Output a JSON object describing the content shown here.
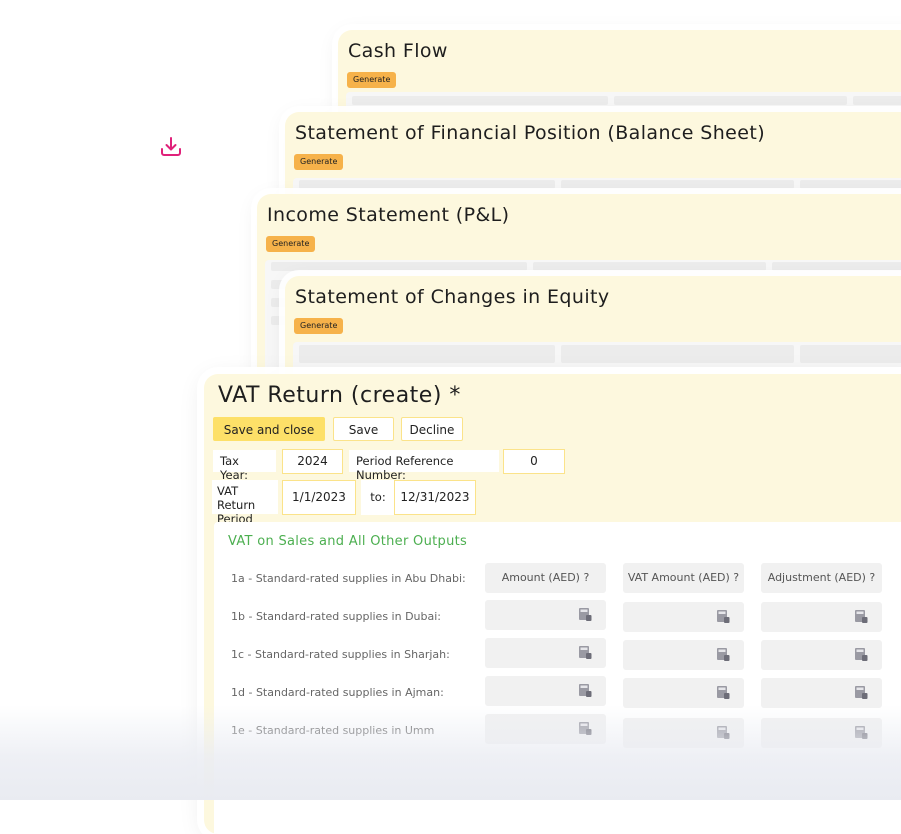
{
  "icons": {
    "download": "download-icon",
    "calculator": "calculator-icon",
    "accent_color": "#e0217a"
  },
  "cards": [
    {
      "title": "Cash Flow",
      "button": "Generate"
    },
    {
      "title": "Statement of Financial Position (Balance Sheet)",
      "button": "Generate"
    },
    {
      "title": "Income Statement (P&L)",
      "button": "Generate"
    },
    {
      "title": "Statement of Changes in Equity",
      "button": "Generate"
    }
  ],
  "vat": {
    "title": "VAT Return (create) *",
    "actions": {
      "save_close": "Save and close",
      "save": "Save",
      "decline": "Decline"
    },
    "tax_year_label": "Tax Year:",
    "tax_year": "2024",
    "period_ref_label": "Period Reference Number:",
    "period_ref": "0",
    "period_label": "VAT Return Period",
    "period_from": "1/1/2023",
    "to_label": "to:",
    "period_to": "12/31/2023",
    "section_title": "VAT on Sales and All Other Outputs",
    "columns": [
      "Amount (AED) ?",
      "VAT Amount (AED) ?",
      "Adjustment (AED) ?"
    ],
    "rows": [
      "1a - Standard-rated supplies in Abu Dhabi:",
      "1b - Standard-rated supplies in Dubai:",
      "1c - Standard-rated supplies in Sharjah:",
      "1d - Standard-rated supplies in Ajman:",
      "1e - Standard-rated supplies in Umm"
    ]
  }
}
